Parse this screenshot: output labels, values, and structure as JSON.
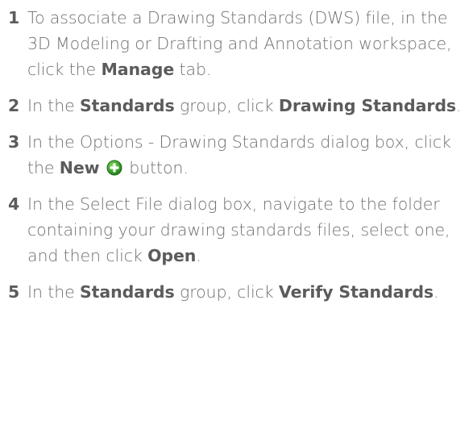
{
  "steps": [
    {
      "number": "1",
      "t1": "To associate a Drawing Standards (DWS) file, in the 3D Modeling or Drafting and Annotation workspace, click the ",
      "b1": "Manage",
      "t2": " tab."
    },
    {
      "number": "2",
      "t1": "In the ",
      "b1": "Standards",
      "t2": " group, click ",
      "b2": "Drawing Standards",
      "t3": "."
    },
    {
      "number": "3",
      "t1": "In the Options - Drawing Standards dialog box, click the ",
      "b1": "New",
      "icon": "add-plus-icon",
      "t2": " button."
    },
    {
      "number": "4",
      "t1": "In the Select File dialog box, navigate to the folder containing your drawing standards files, select one, and then click ",
      "b1": "Open",
      "t2": "."
    },
    {
      "number": "5",
      "t1": "In the ",
      "b1": "Standards",
      "t2": " group, click ",
      "b2": "Verify Standards",
      "t3": "."
    }
  ],
  "colors": {
    "text": "#6f6f6f",
    "bold_text": "#5b5b5b",
    "icon_green": "#3aa12c"
  }
}
